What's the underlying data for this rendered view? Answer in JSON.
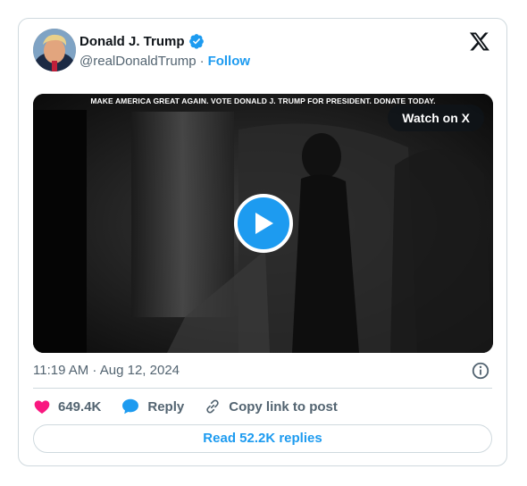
{
  "author": {
    "name": "Donald J. Trump",
    "handle": "@realDonaldTrump",
    "separator": "·",
    "follow_label": "Follow",
    "verified": true
  },
  "media": {
    "banner_text": "MAKE AMERICA GREAT AGAIN. VOTE DONALD J. TRUMP FOR PRESIDENT. DONATE TODAY.",
    "watch_label": "Watch on X"
  },
  "timestamp": "11:19 AM · Aug 12, 2024",
  "actions": {
    "likes": "649.4K",
    "reply_label": "Reply",
    "copy_label": "Copy link to post"
  },
  "read_replies_label": "Read 52.2K replies",
  "colors": {
    "accent": "#1d9bf0",
    "like": "#f91880",
    "muted": "#536471",
    "border": "#cfd9de"
  },
  "icons": [
    "avatar",
    "verified-icon",
    "x-logo-icon",
    "play-icon",
    "info-icon",
    "heart-icon",
    "reply-bubble-icon",
    "link-icon"
  ]
}
